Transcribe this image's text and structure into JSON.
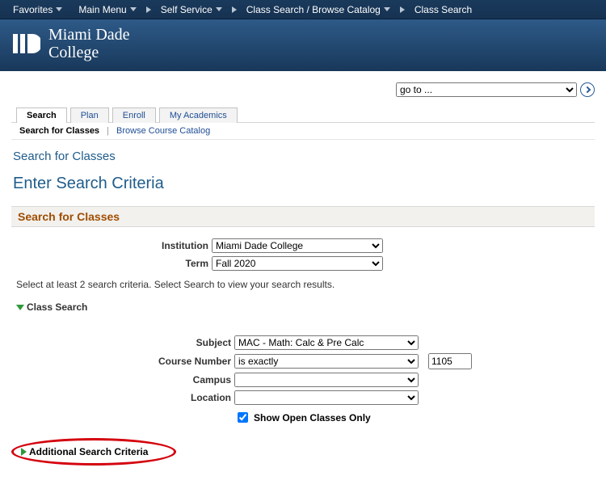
{
  "topnav": {
    "favorites": "Favorites",
    "main_menu": "Main Menu",
    "crumbs": [
      "Self Service",
      "Class Search / Browse Catalog",
      "Class Search"
    ]
  },
  "banner": {
    "line1": "Miami Dade",
    "line2": "College"
  },
  "goto": {
    "placeholder": "go to ..."
  },
  "tabs": {
    "items": [
      "Search",
      "Plan",
      "Enroll",
      "My Academics"
    ],
    "active": 0
  },
  "subtabs": {
    "current": "Search for Classes",
    "other": "Browse Course Catalog"
  },
  "page_title": "Search for Classes",
  "page_heading": "Enter Search Criteria",
  "section_bar": "Search for Classes",
  "form": {
    "institution_label": "Institution",
    "institution_value": "Miami Dade College",
    "term_label": "Term",
    "term_value": "Fall 2020",
    "note": "Select at least 2 search criteria. Select Search to view your search results.",
    "class_search_twisty": "Class Search",
    "subject_label": "Subject",
    "subject_value": "MAC - Math: Calc & Pre Calc",
    "course_number_label": "Course Number",
    "course_number_op": "is exactly",
    "course_number_value": "1105",
    "campus_label": "Campus",
    "campus_value": "",
    "location_label": "Location",
    "location_value": "",
    "show_open_label": "Show Open Classes Only",
    "show_open_checked": true,
    "additional_label": "Additional Search Criteria"
  }
}
